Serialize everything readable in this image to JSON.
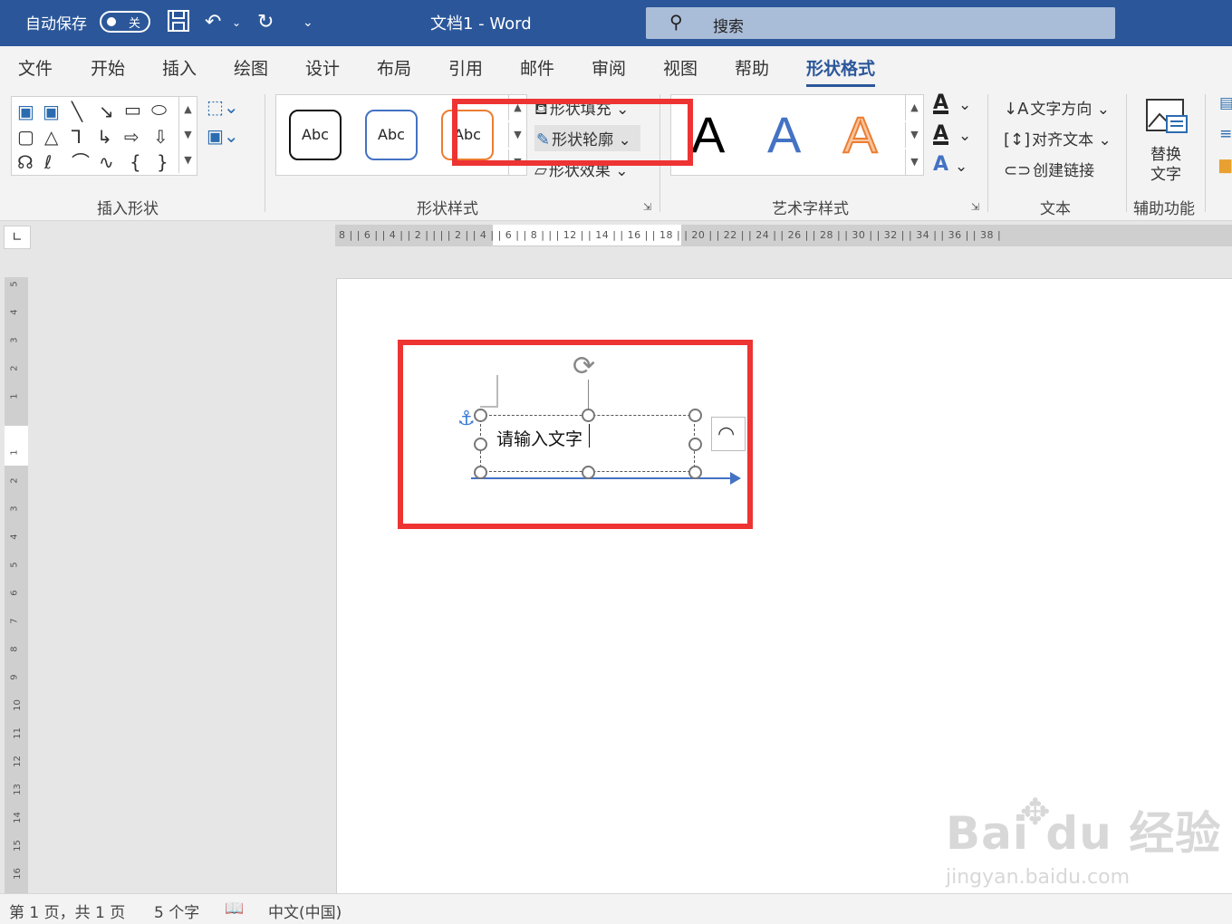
{
  "titlebar": {
    "autosave_label": "自动保存",
    "autosave_state": "关",
    "doc_title": "文档1  -  Word",
    "search_placeholder": "搜索",
    "qat": {
      "save_icon": "save-icon",
      "undo_icon": "undo-icon",
      "redo_icon": "redo-icon",
      "customize_icon": "customize-qat-icon"
    }
  },
  "tabs": [
    "文件",
    "开始",
    "插入",
    "绘图",
    "设计",
    "布局",
    "引用",
    "邮件",
    "审阅",
    "视图",
    "帮助",
    "形状格式"
  ],
  "active_tab": "形状格式",
  "ribbon": {
    "insert_shapes": {
      "label": "插入形状"
    },
    "shape_styles": {
      "label": "形状样式",
      "abc_samples": [
        "Abc",
        "Abc",
        "Abc"
      ],
      "fill_label": "形状填充",
      "outline_label": "形状轮廓",
      "effects_label": "形状效果"
    },
    "wordart_styles": {
      "label": "艺术字样式",
      "samples": [
        "A",
        "A",
        "A"
      ]
    },
    "text": {
      "label": "文本",
      "direction_label": "文字方向",
      "align_label": "对齐文本",
      "link_label": "创建链接"
    },
    "accessibility": {
      "label": "辅助功能",
      "alt_text_line1": "替换",
      "alt_text_line2": "文字"
    }
  },
  "ruler": {
    "horizontal_ticks": "8 |    | 6 |    | 4 |    | 2 |    |    |    | 2 |    | 4 |    | 6 |    | 8 |    |    | 12 |   | 14 |   | 16 |   | 18 |   | 20 |   | 22 |   | 24 |   | 26 |   | 28 |   | 30 |   | 32 |   | 34 |   | 36 |   | 38 |",
    "vertical_numbers": [
      "5",
      "4",
      "3",
      "2",
      "1",
      "1",
      "2",
      "3",
      "4",
      "5",
      "6",
      "7",
      "8",
      "9",
      "10",
      "11",
      "12",
      "13",
      "14",
      "15",
      "16"
    ]
  },
  "document": {
    "textbox_text": "请输入文字"
  },
  "statusbar": {
    "page_info": "第 1 页，共 1 页",
    "word_count": "5 个字",
    "language": "中文(中国)"
  },
  "watermark": {
    "brand": "Bai du 经验",
    "url": "jingyan.baidu.com"
  },
  "colors": {
    "titlebar": "#2b579a",
    "highlight": "#ee3333",
    "wordart_blue": "#4472c4",
    "wordart_orange": "#f4a46a"
  }
}
